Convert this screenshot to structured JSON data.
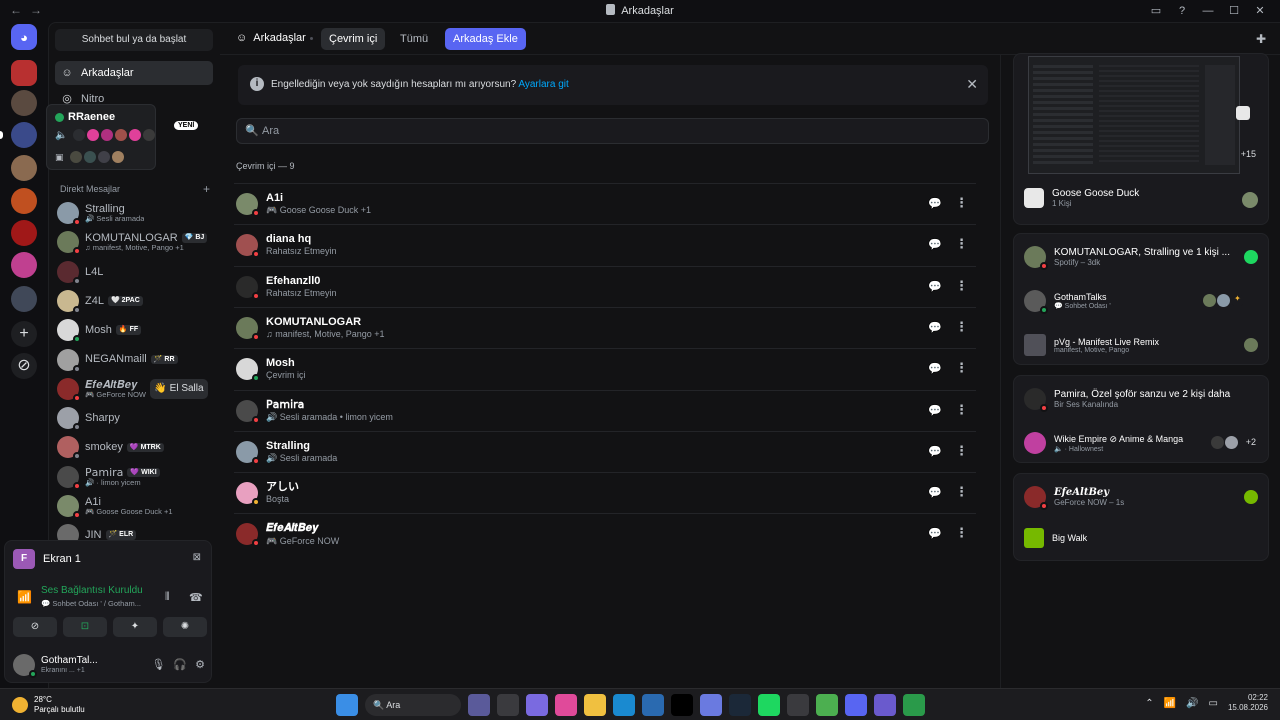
{
  "window": {
    "title": "Arkadaşlar"
  },
  "sidebar": {
    "search_label": "Sohbet bul ya da başlat",
    "friends_label": "Arkadaşlar",
    "nitro_label": "Nitro",
    "new_badge": "YENİ",
    "dm_header": "Direkt Mesajlar",
    "wave_label": "👋 El Salla",
    "dms": [
      {
        "name": "Stralling",
        "sub": "🔊 Sesli aramada",
        "tag": "",
        "color": "#8a9aa8",
        "status": "dnd"
      },
      {
        "name": "KOMUTANLOGAR",
        "sub": "♫ manifest, Motive, Pango +1",
        "tag": "💎 BJ",
        "color": "#6b7a5a",
        "status": "dnd"
      },
      {
        "name": "L4L",
        "sub": "",
        "tag": "",
        "color": "#5a2a30",
        "status": "off"
      },
      {
        "name": "Z4L",
        "sub": "",
        "tag": "🤍 2PAC",
        "color": "#c9b890",
        "status": "off"
      },
      {
        "name": "Mosh",
        "sub": "",
        "tag": "🔥 FF",
        "color": "#d8d8d8",
        "status": "on"
      },
      {
        "name": "NEGANmaill",
        "sub": "",
        "tag": "🪄 RR",
        "color": "#a0a0a0",
        "status": "off"
      },
      {
        "name": "𝑬𝒇𝒆𝑨𝒍𝒕𝑩𝒆𝒚",
        "sub": "🎮 GeForce NOW",
        "tag": "",
        "color": "#8a2a2a",
        "status": "dnd"
      },
      {
        "name": "Sharpy",
        "sub": "",
        "tag": "",
        "color": "#9ca0a8",
        "status": "off"
      },
      {
        "name": "smokey",
        "sub": "",
        "tag": "💜 MTRK",
        "color": "#b06060",
        "status": "off"
      },
      {
        "name": "𝖯𝖺𝗆𝗂𝗋𝖺",
        "sub": "🔊 · limon yicem",
        "tag": "💜 WIKI",
        "color": "#4a4a4a",
        "status": "dnd"
      },
      {
        "name": "A1i",
        "sub": "🎮 Goose Goose Duck +1",
        "tag": "",
        "color": "#7a8a6a",
        "status": "dnd"
      },
      {
        "name": "JIN",
        "sub": "",
        "tag": "🪄 ELR",
        "color": "#6a6a6a",
        "status": "off"
      }
    ],
    "popover": {
      "name": "RRaenee"
    }
  },
  "voice": {
    "screen_label": "Ekran 1",
    "conn_status": "Ses Bağlantısı Kuruldu",
    "conn_sub": "💬 Sohbet Odası ' / Gotham...",
    "user_name": "GothamTal...",
    "user_sub": "Ekranını ... +1"
  },
  "topbar": {
    "friends_label": "Arkadaşlar",
    "tab_online": "Çevrim içi",
    "tab_all": "Tümü",
    "tab_add": "Arkadaş Ekle"
  },
  "notice": {
    "text": "Engellediğin veya yok saydığın hesapları mı arıyorsun?",
    "link": "Ayarlara git"
  },
  "search": {
    "placeholder": "Ara"
  },
  "online_count": "Çevrim içi — 9",
  "friends": [
    {
      "name": "A1i",
      "sub": "🎮 Goose Goose Duck +1",
      "color": "#7a8a6a",
      "status": "dnd"
    },
    {
      "name": "diana hq",
      "sub": "Rahatsız Etmeyin",
      "color": "#a05050",
      "status": "dnd"
    },
    {
      "name": "Efehanzll0",
      "sub": "Rahatsız Etmeyin",
      "color": "#2a2a2a",
      "status": "dnd"
    },
    {
      "name": "KOMUTANLOGAR",
      "sub": "♫ manifest, Motive, Pango +1",
      "color": "#6b7a5a",
      "status": "dnd"
    },
    {
      "name": "Mosh",
      "sub": "Çevrim içi",
      "color": "#d8d8d8",
      "status": "on"
    },
    {
      "name": "𝖯𝖺𝗆𝗂𝗋𝖺",
      "sub": "🔊 Sesli aramada • limon yicem",
      "color": "#4a4a4a",
      "status": "dnd"
    },
    {
      "name": "Stralling",
      "sub": "🔊 Sesli aramada",
      "color": "#8a9aa8",
      "status": "dnd"
    },
    {
      "name": "アしい",
      "sub": "Boşta",
      "color": "#e8a0c0",
      "status": "idle"
    },
    {
      "name": "𝑬𝒇𝒆𝑨𝒍𝒕𝑩𝒆𝒚",
      "sub": "🎮 GeForce NOW",
      "color": "#8a2a2a",
      "status": "dnd"
    }
  ],
  "active_now": {
    "card1": {
      "plus": "+15",
      "game": "Goose Goose Duck",
      "game_sub": "1 Kişi"
    },
    "card2": {
      "title": "KOMUTANLOGAR, Stralling ve 1 kişi ...",
      "sub": "Spotify – 3dk",
      "row1_title": "GothamTalks",
      "row1_sub": "💬 Sohbet Odası '",
      "row2_title": "pVg - Manifest Live Remix",
      "row2_sub": "manifest, Motive, Pango"
    },
    "card3": {
      "title": "Pamira, Özel şoför sanzu ve 2 kişi daha",
      "sub": "Bir Ses Kanalında",
      "row_title": "Wikie Empire ⊘ Anime & Manga",
      "row_sub": "🔈 · Hallownest",
      "plus": "+2"
    },
    "card4": {
      "title": "𝑬𝒇𝒆𝑨𝒍𝒕𝑩𝒆𝒚",
      "sub": "GeForce NOW – 1s",
      "row_title": "Big Walk"
    }
  },
  "taskbar": {
    "temp": "28°C",
    "weather": "Parçalı bulutlu",
    "search": "Ara",
    "time": "02:22",
    "date": "15.08.2026"
  }
}
